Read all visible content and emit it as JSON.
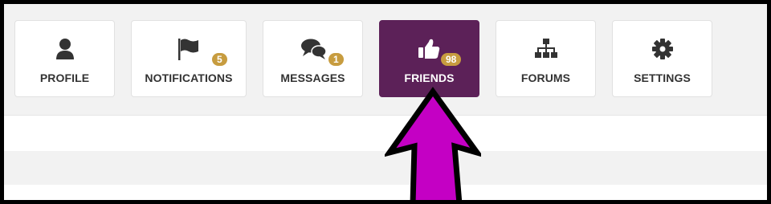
{
  "tabs": [
    {
      "id": "profile",
      "label": "PROFILE",
      "icon": "user-icon",
      "badge": null
    },
    {
      "id": "notifications",
      "label": "NOTIFICATIONS",
      "icon": "flag-icon",
      "badge": "5"
    },
    {
      "id": "messages",
      "label": "MESSAGES",
      "icon": "comments-icon",
      "badge": "1"
    },
    {
      "id": "friends",
      "label": "FRIENDS",
      "icon": "thumbs-up-icon",
      "badge": "98",
      "active": true
    },
    {
      "id": "forums",
      "label": "FORUMS",
      "icon": "sitemap-icon",
      "badge": null
    },
    {
      "id": "settings",
      "label": "SETTINGS",
      "icon": "gear-icon",
      "badge": null
    }
  ],
  "colors": {
    "active_tab": "#5c2158",
    "badge": "#c79c3f",
    "arrow": "#c400c4",
    "tab_text": "#333333",
    "background": "#f2f2f2"
  },
  "annotation": {
    "icon": "arrow-up-icon",
    "points_to": "friends"
  }
}
